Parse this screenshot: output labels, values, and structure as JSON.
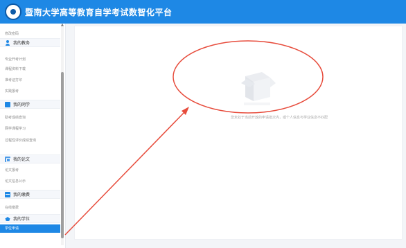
{
  "header": {
    "title": "暨南大学高等教育自学考试数智化平台",
    "logo_icon": "university-seal-icon",
    "brand_color": "#1e88e5"
  },
  "sidebar": {
    "top_item": "修改密码",
    "groups": [
      {
        "label": "我的教务",
        "icon": "user-icon",
        "items": [
          "专业开考计划",
          "课程资料下载",
          "准考证打印",
          "实践报考"
        ]
      },
      {
        "label": "我的网学",
        "icon": "online-study-icon",
        "items": [
          "助考成绩查询",
          "网学课程学习",
          "过程性评价成绩查询"
        ]
      },
      {
        "label": "我的论文",
        "icon": "thesis-icon",
        "items": [
          "论文报考",
          "论文信息公示"
        ]
      },
      {
        "label": "我的缴费",
        "icon": "payment-icon",
        "items": [
          "在线缴费"
        ]
      },
      {
        "label": "我的学位",
        "icon": "degree-cap-icon",
        "items": [
          "学位申请"
        ]
      }
    ],
    "active_item": "学位申请"
  },
  "main": {
    "empty_message": "您未处于当前开放的申请批次内，或个人信息与学业信息不匹配"
  },
  "annotations": {
    "color": "#e74c3c"
  }
}
